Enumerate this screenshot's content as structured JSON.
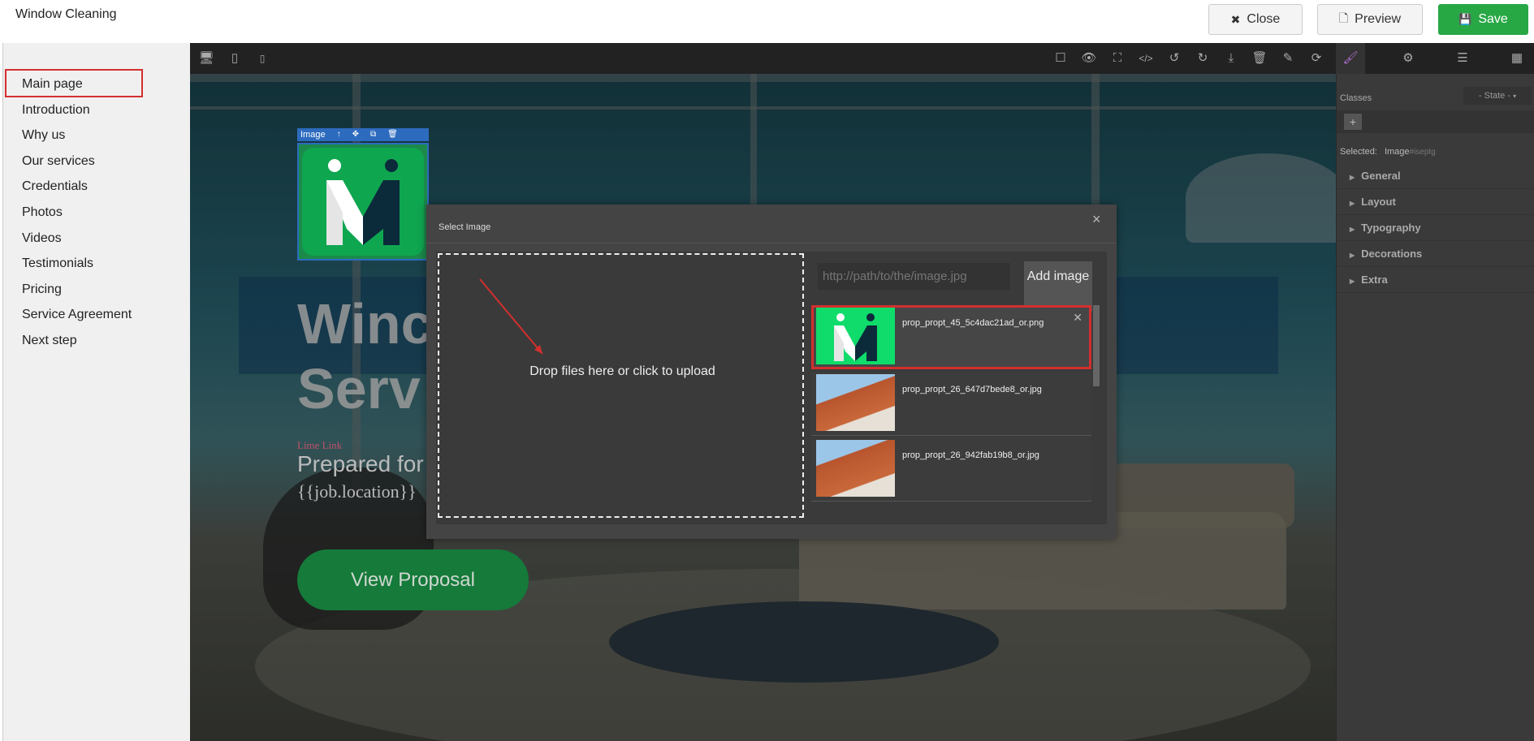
{
  "app": {
    "title": "Window Cleaning"
  },
  "top_buttons": {
    "close": "Close",
    "preview": "Preview",
    "save": "Save"
  },
  "sidebar": {
    "items": [
      "Main page",
      "Introduction",
      "Why us",
      "Our services",
      "Credentials",
      "Photos",
      "Videos",
      "Testimonials",
      "Pricing",
      "Service Agreement",
      "Next step"
    ],
    "active": "Main page"
  },
  "toolbar": {
    "device_icons": [
      "desktop-icon",
      "tablet-icon",
      "mobile-icon"
    ],
    "action_icons": [
      "square-outline-icon",
      "eye-icon",
      "fullscreen-icon",
      "code-icon",
      "undo-icon",
      "redo-icon",
      "download-icon",
      "trash-icon",
      "edit-icon",
      "refresh-icon"
    ],
    "panel_icons": [
      "brush-icon",
      "gear-icon",
      "layers-icon",
      "blocks-icon"
    ]
  },
  "canvas": {
    "selected_label": "Image",
    "hero_title_line1": "Winc",
    "hero_title_line2": "Serv",
    "lime_link": "Lime Link",
    "prepared_for": "Prepared for",
    "location": "{{job.location}}",
    "view_button": "View Proposal"
  },
  "style_manager": {
    "classes_label": "Classes",
    "state": "- State -",
    "add_label": "+",
    "selected_label": "Selected:",
    "selected_tag": "Image",
    "selected_id": "#iseptg",
    "sectors": [
      "General",
      "Layout",
      "Typography",
      "Decorations",
      "Extra"
    ]
  },
  "modal": {
    "title": "Select Image",
    "close": "×",
    "drop_text": "Drop files here or click to upload",
    "url_placeholder": "http://path/to/the/image.jpg",
    "add_button": "Add image",
    "assets": [
      {
        "name": "prop_propt_45_5c4dac21ad_or.png",
        "selected": true
      },
      {
        "name": "prop_propt_26_647d7bede8_or.jpg",
        "selected": false
      },
      {
        "name": "prop_propt_26_942fab19b8_or.jpg",
        "selected": false
      }
    ]
  },
  "colors": {
    "save_green": "#28a745",
    "highlight_red": "#d32f2f",
    "selection_blue": "#2d6bbf",
    "logo_green": "#0fa650"
  }
}
